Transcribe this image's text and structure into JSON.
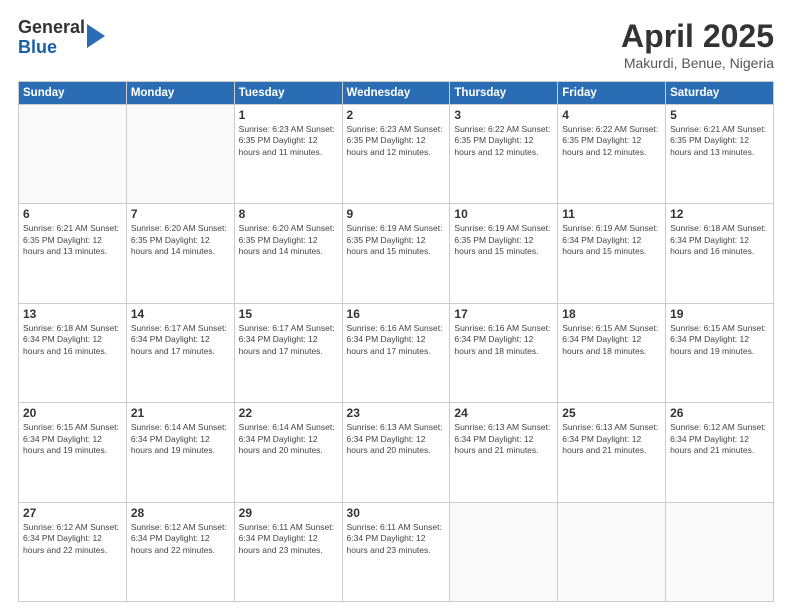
{
  "logo": {
    "general": "General",
    "blue": "Blue"
  },
  "header": {
    "month": "April 2025",
    "location": "Makurdi, Benue, Nigeria"
  },
  "days_of_week": [
    "Sunday",
    "Monday",
    "Tuesday",
    "Wednesday",
    "Thursday",
    "Friday",
    "Saturday"
  ],
  "weeks": [
    [
      {
        "day": "",
        "info": ""
      },
      {
        "day": "",
        "info": ""
      },
      {
        "day": "1",
        "info": "Sunrise: 6:23 AM\nSunset: 6:35 PM\nDaylight: 12 hours and 11 minutes."
      },
      {
        "day": "2",
        "info": "Sunrise: 6:23 AM\nSunset: 6:35 PM\nDaylight: 12 hours and 12 minutes."
      },
      {
        "day": "3",
        "info": "Sunrise: 6:22 AM\nSunset: 6:35 PM\nDaylight: 12 hours and 12 minutes."
      },
      {
        "day": "4",
        "info": "Sunrise: 6:22 AM\nSunset: 6:35 PM\nDaylight: 12 hours and 12 minutes."
      },
      {
        "day": "5",
        "info": "Sunrise: 6:21 AM\nSunset: 6:35 PM\nDaylight: 12 hours and 13 minutes."
      }
    ],
    [
      {
        "day": "6",
        "info": "Sunrise: 6:21 AM\nSunset: 6:35 PM\nDaylight: 12 hours and 13 minutes."
      },
      {
        "day": "7",
        "info": "Sunrise: 6:20 AM\nSunset: 6:35 PM\nDaylight: 12 hours and 14 minutes."
      },
      {
        "day": "8",
        "info": "Sunrise: 6:20 AM\nSunset: 6:35 PM\nDaylight: 12 hours and 14 minutes."
      },
      {
        "day": "9",
        "info": "Sunrise: 6:19 AM\nSunset: 6:35 PM\nDaylight: 12 hours and 15 minutes."
      },
      {
        "day": "10",
        "info": "Sunrise: 6:19 AM\nSunset: 6:35 PM\nDaylight: 12 hours and 15 minutes."
      },
      {
        "day": "11",
        "info": "Sunrise: 6:19 AM\nSunset: 6:34 PM\nDaylight: 12 hours and 15 minutes."
      },
      {
        "day": "12",
        "info": "Sunrise: 6:18 AM\nSunset: 6:34 PM\nDaylight: 12 hours and 16 minutes."
      }
    ],
    [
      {
        "day": "13",
        "info": "Sunrise: 6:18 AM\nSunset: 6:34 PM\nDaylight: 12 hours and 16 minutes."
      },
      {
        "day": "14",
        "info": "Sunrise: 6:17 AM\nSunset: 6:34 PM\nDaylight: 12 hours and 17 minutes."
      },
      {
        "day": "15",
        "info": "Sunrise: 6:17 AM\nSunset: 6:34 PM\nDaylight: 12 hours and 17 minutes."
      },
      {
        "day": "16",
        "info": "Sunrise: 6:16 AM\nSunset: 6:34 PM\nDaylight: 12 hours and 17 minutes."
      },
      {
        "day": "17",
        "info": "Sunrise: 6:16 AM\nSunset: 6:34 PM\nDaylight: 12 hours and 18 minutes."
      },
      {
        "day": "18",
        "info": "Sunrise: 6:15 AM\nSunset: 6:34 PM\nDaylight: 12 hours and 18 minutes."
      },
      {
        "day": "19",
        "info": "Sunrise: 6:15 AM\nSunset: 6:34 PM\nDaylight: 12 hours and 19 minutes."
      }
    ],
    [
      {
        "day": "20",
        "info": "Sunrise: 6:15 AM\nSunset: 6:34 PM\nDaylight: 12 hours and 19 minutes."
      },
      {
        "day": "21",
        "info": "Sunrise: 6:14 AM\nSunset: 6:34 PM\nDaylight: 12 hours and 19 minutes."
      },
      {
        "day": "22",
        "info": "Sunrise: 6:14 AM\nSunset: 6:34 PM\nDaylight: 12 hours and 20 minutes."
      },
      {
        "day": "23",
        "info": "Sunrise: 6:13 AM\nSunset: 6:34 PM\nDaylight: 12 hours and 20 minutes."
      },
      {
        "day": "24",
        "info": "Sunrise: 6:13 AM\nSunset: 6:34 PM\nDaylight: 12 hours and 21 minutes."
      },
      {
        "day": "25",
        "info": "Sunrise: 6:13 AM\nSunset: 6:34 PM\nDaylight: 12 hours and 21 minutes."
      },
      {
        "day": "26",
        "info": "Sunrise: 6:12 AM\nSunset: 6:34 PM\nDaylight: 12 hours and 21 minutes."
      }
    ],
    [
      {
        "day": "27",
        "info": "Sunrise: 6:12 AM\nSunset: 6:34 PM\nDaylight: 12 hours and 22 minutes."
      },
      {
        "day": "28",
        "info": "Sunrise: 6:12 AM\nSunset: 6:34 PM\nDaylight: 12 hours and 22 minutes."
      },
      {
        "day": "29",
        "info": "Sunrise: 6:11 AM\nSunset: 6:34 PM\nDaylight: 12 hours and 23 minutes."
      },
      {
        "day": "30",
        "info": "Sunrise: 6:11 AM\nSunset: 6:34 PM\nDaylight: 12 hours and 23 minutes."
      },
      {
        "day": "",
        "info": ""
      },
      {
        "day": "",
        "info": ""
      },
      {
        "day": "",
        "info": ""
      }
    ]
  ]
}
